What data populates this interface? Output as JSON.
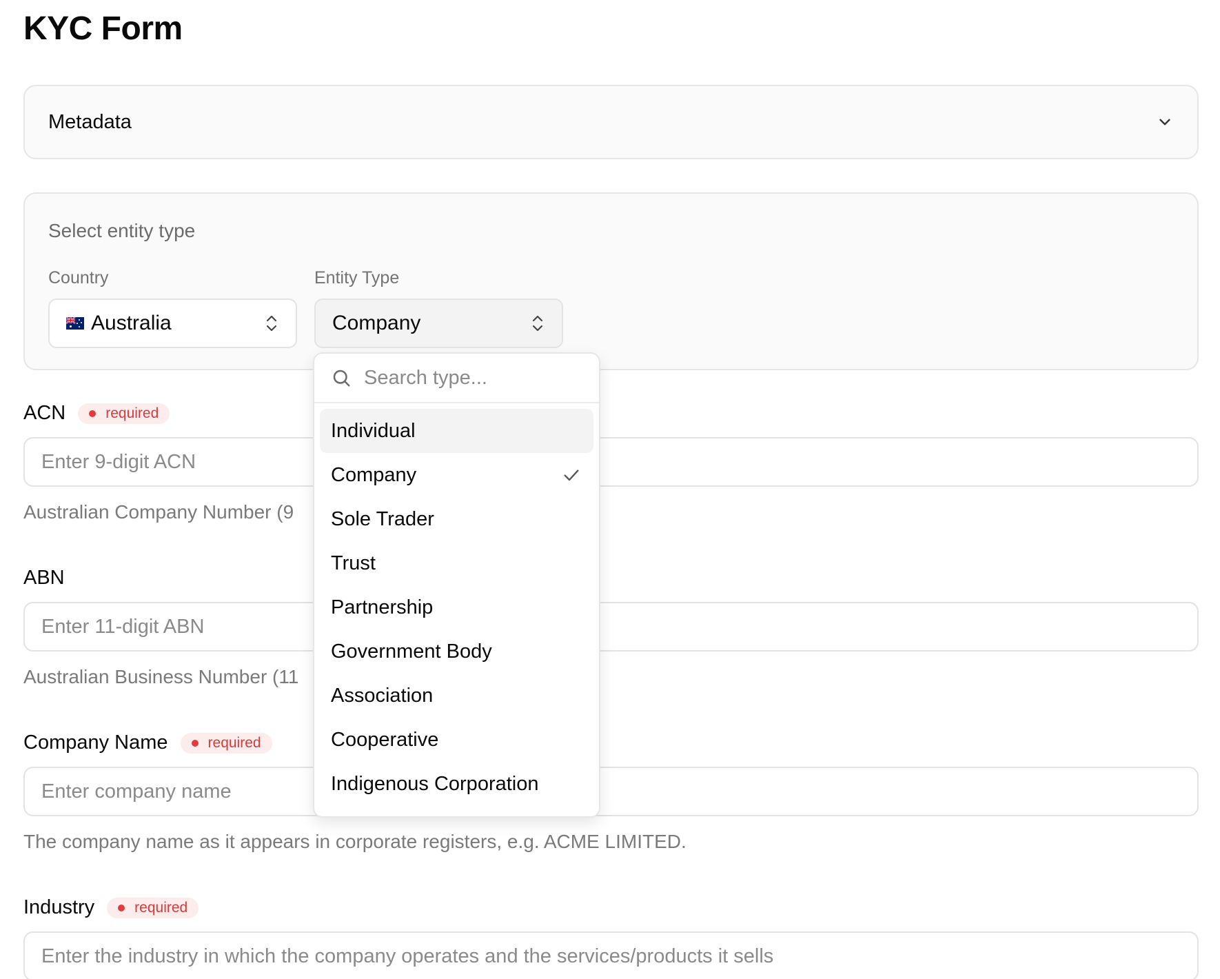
{
  "page": {
    "title": "KYC Form"
  },
  "metadata": {
    "label": "Metadata"
  },
  "entity": {
    "title": "Select entity type",
    "country_label": "Country",
    "country_value": "Australia",
    "country_flag": "australia-flag-icon",
    "type_label": "Entity Type",
    "type_value": "Company"
  },
  "dropdown": {
    "search_placeholder": "Search type...",
    "options": [
      {
        "label": "Individual",
        "highlighted": true,
        "selected": false
      },
      {
        "label": "Company",
        "highlighted": false,
        "selected": true
      },
      {
        "label": "Sole Trader",
        "highlighted": false,
        "selected": false
      },
      {
        "label": "Trust",
        "highlighted": false,
        "selected": false
      },
      {
        "label": "Partnership",
        "highlighted": false,
        "selected": false
      },
      {
        "label": "Government Body",
        "highlighted": false,
        "selected": false
      },
      {
        "label": "Association",
        "highlighted": false,
        "selected": false
      },
      {
        "label": "Cooperative",
        "highlighted": false,
        "selected": false
      },
      {
        "label": "Indigenous Corporation",
        "highlighted": false,
        "selected": false
      }
    ]
  },
  "fields": {
    "acn": {
      "label": "ACN",
      "badge": "required",
      "placeholder": "Enter 9-digit ACN",
      "help": "Australian Company Number (9"
    },
    "abn": {
      "label": "ABN",
      "placeholder": "Enter 11-digit ABN",
      "help": "Australian Business Number (11"
    },
    "company_name": {
      "label": "Company Name",
      "badge": "required",
      "placeholder": "Enter company name",
      "help": "The company name as it appears in corporate registers, e.g. ACME LIMITED."
    },
    "industry": {
      "label": "Industry",
      "badge": "required",
      "placeholder": "Enter the industry in which the company operates and the services/products it sells"
    }
  },
  "colors": {
    "required_text": "#d63b3b",
    "required_bg": "#fdecec",
    "card_bg": "#fafafa",
    "border": "#e6e6e6"
  }
}
